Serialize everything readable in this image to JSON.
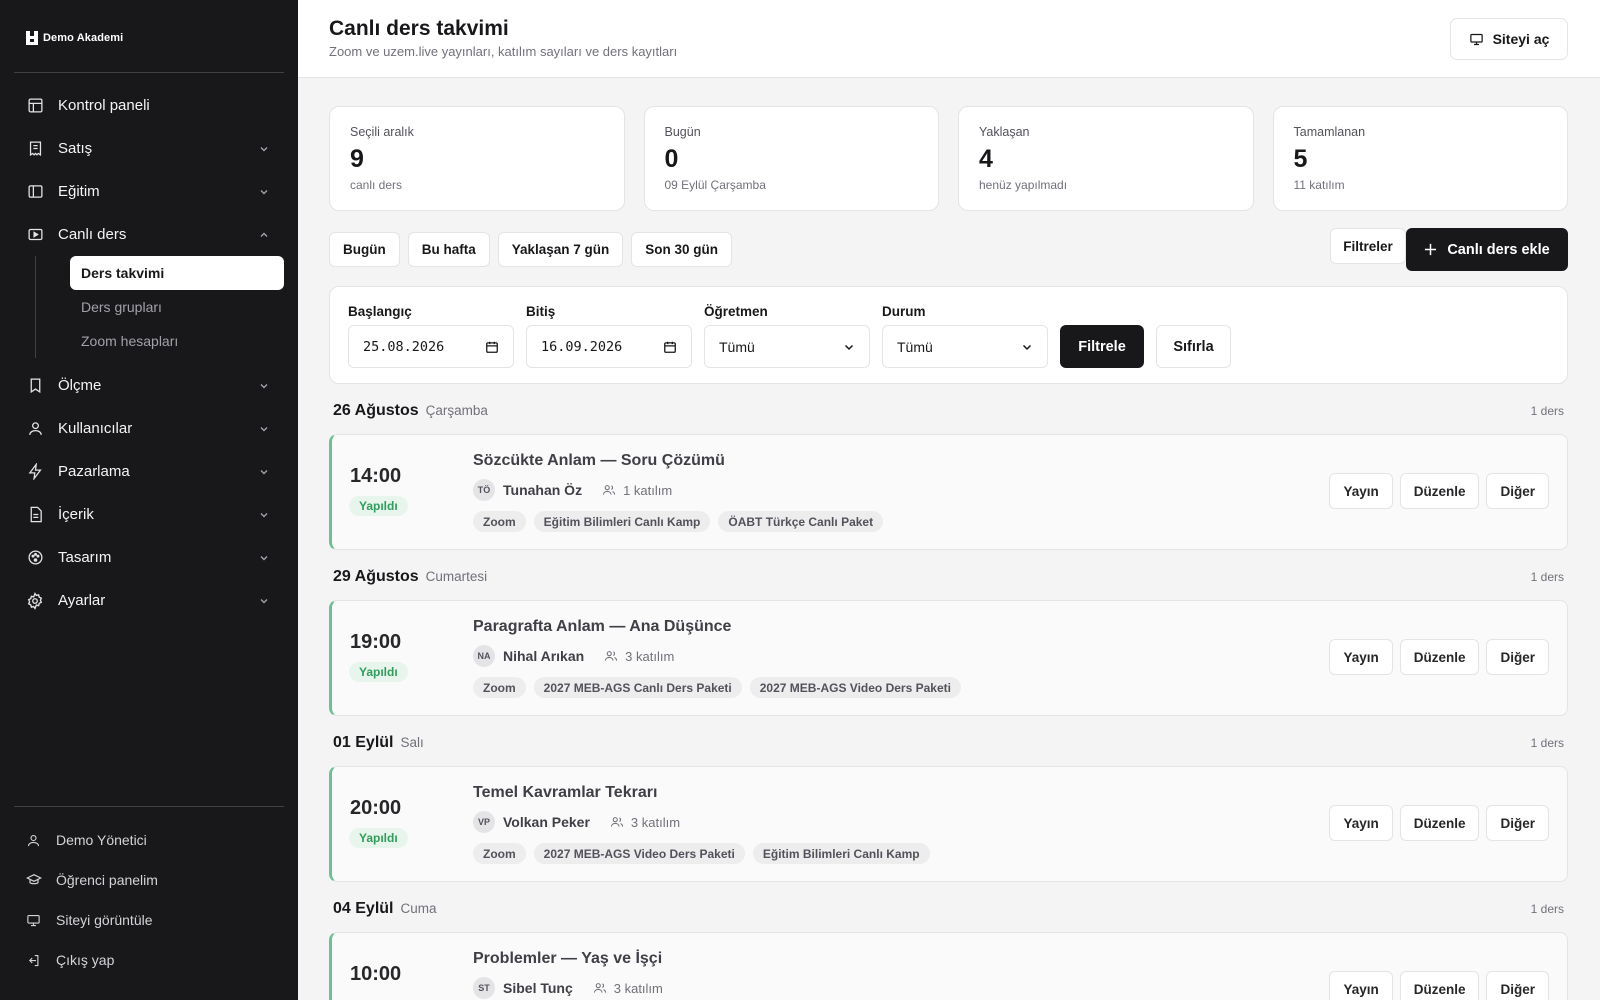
{
  "brand": {
    "name": "Demo Akademi"
  },
  "sidebar": {
    "items": [
      {
        "label": "Kontrol paneli",
        "icon": "dashboard-icon"
      },
      {
        "label": "Satış",
        "icon": "receipt-icon"
      },
      {
        "label": "Eğitim",
        "icon": "book-icon"
      },
      {
        "label": "Canlı ders",
        "icon": "video-icon"
      },
      {
        "label": "Ölçme",
        "icon": "bookmark-icon"
      },
      {
        "label": "Kullanıcılar",
        "icon": "user-icon"
      },
      {
        "label": "Pazarlama",
        "icon": "bolt-icon"
      },
      {
        "label": "İçerik",
        "icon": "file-icon"
      },
      {
        "label": "Tasarım",
        "icon": "palette-icon"
      },
      {
        "label": "Ayarlar",
        "icon": "gear-icon"
      }
    ],
    "sub_items": [
      "Ders takvimi",
      "Ders grupları",
      "Zoom hesapları"
    ],
    "bottom": [
      {
        "label": "Demo Yönetici",
        "icon": "user-icon"
      },
      {
        "label": "Öğrenci panelim",
        "icon": "graduation-cap-icon"
      },
      {
        "label": "Siteyi görüntüle",
        "icon": "monitor-icon"
      },
      {
        "label": "Çıkış yap",
        "icon": "logout-icon"
      }
    ]
  },
  "header": {
    "title": "Canlı ders takvimi",
    "subtitle": "Zoom ve uzem.live yayınları, katılım sayıları ve ders kayıtları",
    "open_site": "Siteyi aç"
  },
  "stats": [
    {
      "label": "Seçili aralık",
      "value": "9",
      "sub": "canlı ders"
    },
    {
      "label": "Bugün",
      "value": "0",
      "sub": "09 Eylül Çarşamba"
    },
    {
      "label": "Yaklaşan",
      "value": "4",
      "sub": "henüz yapılmadı"
    },
    {
      "label": "Tamamlanan",
      "value": "5",
      "sub": "11 katılım"
    }
  ],
  "toolbar": {
    "quick": [
      "Bugün",
      "Bu hafta",
      "Yaklaşan 7 gün",
      "Son 30 gün"
    ],
    "filters": "Filtreler",
    "add": "Canlı ders ekle"
  },
  "filter_form": {
    "start_label": "Başlangıç",
    "start_value": "25.08.2026",
    "end_label": "Bitiş",
    "end_value": "16.09.2026",
    "teacher_label": "Öğretmen",
    "teacher_value": "Tümü",
    "status_label": "Durum",
    "status_value": "Tümü",
    "apply": "Filtrele",
    "reset": "Sıfırla"
  },
  "lesson_actions": {
    "stream": "Yayın",
    "edit": "Düzenle",
    "more": "Diğer"
  },
  "days": [
    {
      "date": "26 Ağustos",
      "weekday": "Çarşamba",
      "count": "1 ders",
      "lesson": {
        "time": "14:00",
        "status": "Yapıldı",
        "title": "Sözcükte Anlam — Soru Çözümü",
        "initials": "TÖ",
        "teacher": "Tunahan Öz",
        "attendance": "1 katılım",
        "tags": [
          "Zoom",
          "Eğitim Bilimleri Canlı Kamp",
          "ÖABT Türkçe Canlı Paket"
        ]
      }
    },
    {
      "date": "29 Ağustos",
      "weekday": "Cumartesi",
      "count": "1 ders",
      "lesson": {
        "time": "19:00",
        "status": "Yapıldı",
        "title": "Paragrafta Anlam — Ana Düşünce",
        "initials": "NA",
        "teacher": "Nihal Arıkan",
        "attendance": "3 katılım",
        "tags": [
          "Zoom",
          "2027 MEB-AGS Canlı Ders Paketi",
          "2027 MEB-AGS Video Ders Paketi"
        ]
      }
    },
    {
      "date": "01 Eylül",
      "weekday": "Salı",
      "count": "1 ders",
      "lesson": {
        "time": "20:00",
        "status": "Yapıldı",
        "title": "Temel Kavramlar Tekrarı",
        "initials": "VP",
        "teacher": "Volkan Peker",
        "attendance": "3 katılım",
        "tags": [
          "Zoom",
          "2027 MEB-AGS Video Ders Paketi",
          "Eğitim Bilimleri Canlı Kamp"
        ]
      }
    },
    {
      "date": "04 Eylül",
      "weekday": "Cuma",
      "count": "1 ders",
      "lesson": {
        "time": "10:00",
        "status": "",
        "title": "Problemler — Yaş ve İşçi",
        "initials": "ST",
        "teacher": "Sibel Tunç",
        "attendance": "3 katılım",
        "tags": []
      }
    }
  ]
}
